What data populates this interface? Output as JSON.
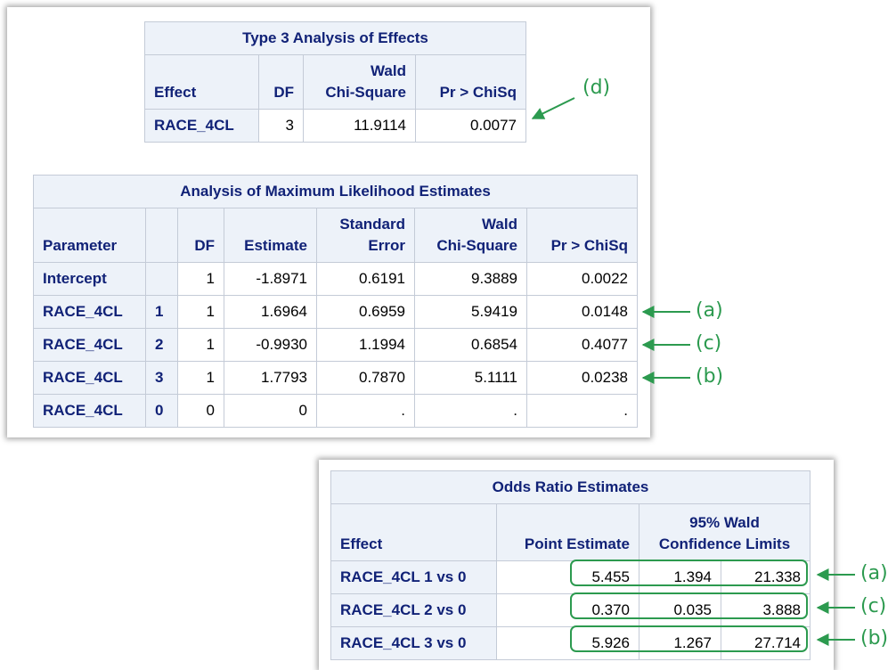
{
  "type3": {
    "title": "Type 3 Analysis of Effects",
    "headers": {
      "effect": "Effect",
      "df": "DF",
      "wald_line1": "Wald",
      "wald_line2": "Chi-Square",
      "p": "Pr > ChiSq"
    },
    "rows": [
      {
        "effect": "RACE_4CL",
        "df": "3",
        "wald": "11.9114",
        "p": "0.0077"
      }
    ]
  },
  "mle": {
    "title": "Analysis of Maximum Likelihood Estimates",
    "headers": {
      "parameter": "Parameter",
      "level": "",
      "df": "DF",
      "estimate": "Estimate",
      "se_line1": "Standard",
      "se_line2": "Error",
      "wald_line1": "Wald",
      "wald_line2": "Chi-Square",
      "p": "Pr > ChiSq"
    },
    "rows": [
      {
        "parameter": "Intercept",
        "level": "",
        "df": "1",
        "estimate": "-1.8971",
        "se": "0.6191",
        "wald": "9.3889",
        "p": "0.0022"
      },
      {
        "parameter": "RACE_4CL",
        "level": "1",
        "df": "1",
        "estimate": "1.6964",
        "se": "0.6959",
        "wald": "5.9419",
        "p": "0.0148"
      },
      {
        "parameter": "RACE_4CL",
        "level": "2",
        "df": "1",
        "estimate": "-0.9930",
        "se": "1.1994",
        "wald": "0.6854",
        "p": "0.4077"
      },
      {
        "parameter": "RACE_4CL",
        "level": "3",
        "df": "1",
        "estimate": "1.7793",
        "se": "0.7870",
        "wald": "5.1111",
        "p": "0.0238"
      },
      {
        "parameter": "RACE_4CL",
        "level": "0",
        "df": "0",
        "estimate": "0",
        "se": ".",
        "wald": ".",
        "p": "."
      }
    ]
  },
  "odds": {
    "title": "Odds Ratio Estimates",
    "headers": {
      "effect": "Effect",
      "point": "Point Estimate",
      "ci_line1": "95% Wald",
      "ci_line2": "Confidence Limits"
    },
    "rows": [
      {
        "effect": "RACE_4CL 1 vs 0",
        "point": "5.455",
        "lower": "1.394",
        "upper": "21.338"
      },
      {
        "effect": "RACE_4CL 2 vs 0",
        "point": "0.370",
        "lower": "0.035",
        "upper": "3.888"
      },
      {
        "effect": "RACE_4CL 3 vs 0",
        "point": "5.926",
        "lower": "1.267",
        "upper": "27.714"
      }
    ]
  },
  "annotations": {
    "d": "(d)",
    "mle_a": "(a)",
    "mle_c": "(c)",
    "mle_b": "(b)",
    "or_a": "(a)",
    "or_c": "(c)",
    "or_b": "(b)",
    "color": "#2c9a4f"
  },
  "colors": {
    "header_bg": "#edf2f9",
    "header_text": "#112277",
    "border": "#c4cbd7"
  }
}
